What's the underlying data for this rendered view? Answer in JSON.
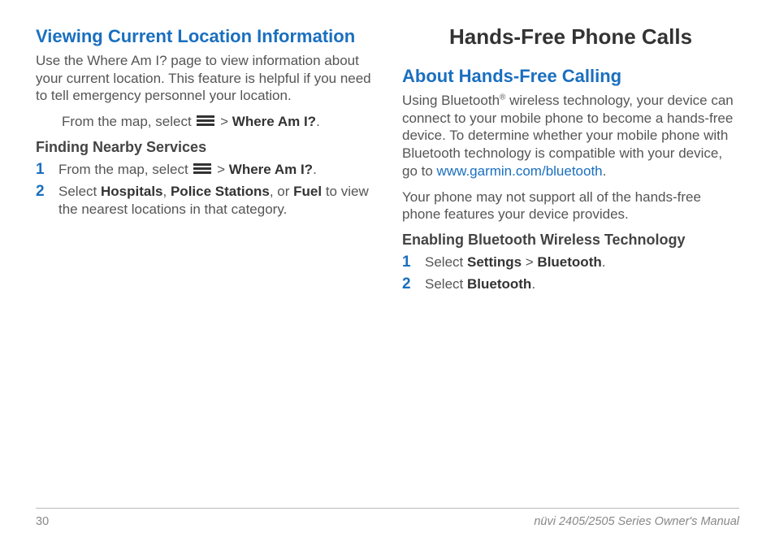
{
  "left": {
    "h2": "Viewing Current Location Information",
    "intro": "Use the Where Am I? page to view information about your current location. This feature is helpful if you need to tell emergency personnel your location.",
    "mapline_pre": "From the map, select ",
    "mapline_post": " > ",
    "whereami": "Where Am I?",
    "dot": ".",
    "h3": "Finding Nearby Services",
    "step1_pre": "From the map, select ",
    "step1_post": " > ",
    "step2_pre": "Select ",
    "hospitals": "Hospitals",
    "comma": ", ",
    "police": "Police Stations",
    "or": ", or ",
    "fuel": "Fuel",
    "step2_post": " to view the nearest locations in that category."
  },
  "right": {
    "chapter": "Hands-Free Phone Calls",
    "h2": "About Hands-Free Calling",
    "p1a": "Using Bluetooth",
    "reg": "®",
    "p1b": " wireless technology, your device can connect to your mobile phone to become a hands-free device. To determine whether your mobile phone with Bluetooth technology is compatible with your device, go to ",
    "link": "www.garmin.com/bluetooth",
    "dot": ".",
    "p2": "Your phone may not support all of the hands-free phone features your device provides.",
    "h3": "Enabling Bluetooth Wireless Technology",
    "s1_pre": "Select ",
    "settings": "Settings",
    "gt": " > ",
    "bluetooth": "Bluetooth",
    "s2_pre": "Select "
  },
  "footer": {
    "page": "30",
    "title": "nüvi 2405/2505 Series Owner's Manual"
  },
  "numbers": {
    "one": "1",
    "two": "2"
  }
}
